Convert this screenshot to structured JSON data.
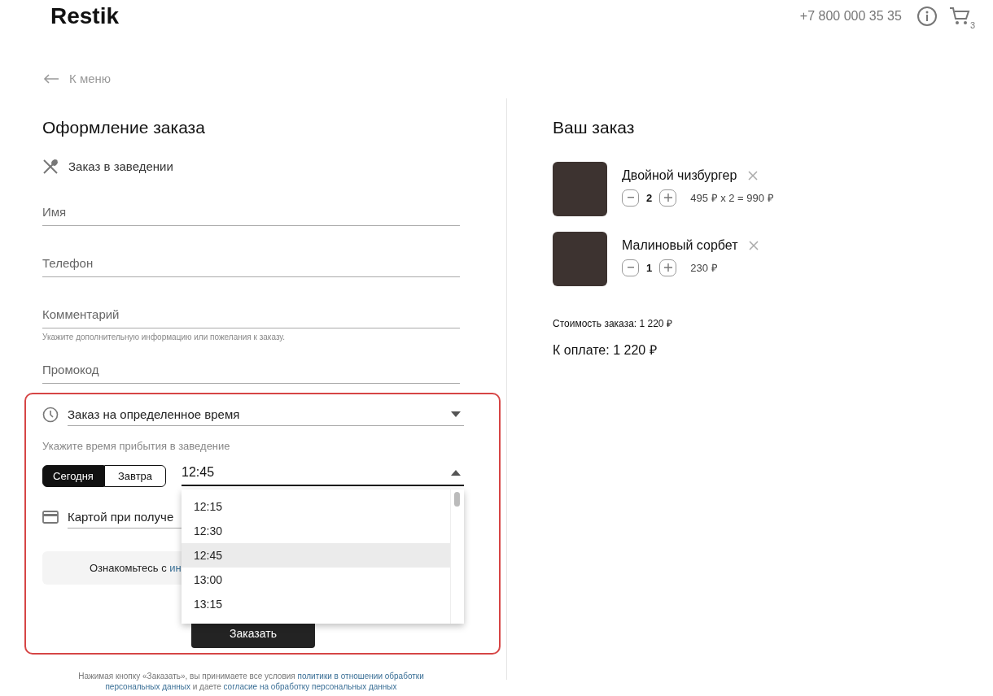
{
  "header": {
    "logo": "Restik",
    "phone": "+7 800 000 35 35",
    "cart_count": "3"
  },
  "back_link": "К меню",
  "checkout": {
    "title": "Оформление заказа",
    "order_type": "Заказ в заведении",
    "fields": [
      {
        "placeholder": "Имя"
      },
      {
        "placeholder": "Телефон"
      },
      {
        "placeholder": "Комментарий",
        "hint": "Укажите дополнительную информацию или пожелания к заказу."
      },
      {
        "placeholder": "Промокод"
      }
    ],
    "time_mode": "Заказ на определенное время",
    "arrival_hint": "Укажите время прибытия в заведение",
    "days": [
      {
        "label": "Сегодня",
        "selected": true
      },
      {
        "label": "Завтра",
        "selected": false
      }
    ],
    "time": {
      "value": "12:45",
      "expanded": true,
      "options": [
        {
          "label": "12:15",
          "selected": false
        },
        {
          "label": "12:30",
          "selected": false
        },
        {
          "label": "12:45",
          "selected": true
        },
        {
          "label": "13:00",
          "selected": false
        },
        {
          "label": "13:15",
          "selected": false
        }
      ]
    },
    "payment": "Картой при получе",
    "info": [
      {
        "text": "Ознакомьтесь с ",
        "link": false
      },
      {
        "text": "ин",
        "link": true
      }
    ],
    "submit": "Заказать",
    "disclaimer": [
      [
        {
          "text": "Нажимая кнопку «Заказать», вы принимаете все условия ",
          "link": false
        },
        {
          "text": "политики в отношении обработки",
          "link": true
        }
      ],
      [
        {
          "text": "персональных данных",
          "link": true
        },
        {
          "text": " и даете ",
          "link": false
        },
        {
          "text": "согласие на обработку персональных данных",
          "link": true
        }
      ]
    ]
  },
  "order": {
    "title": "Ваш заказ",
    "items": [
      {
        "name": "Двойной чизбургер",
        "qty": "2",
        "price": "495 ₽ x 2 = 990 ₽"
      },
      {
        "name": "Малиновый сорбет",
        "qty": "1",
        "price": "230 ₽"
      }
    ],
    "subtotal": "Стоимость заказа: 1 220 ₽",
    "total": "К оплате: 1 220 ₽"
  }
}
